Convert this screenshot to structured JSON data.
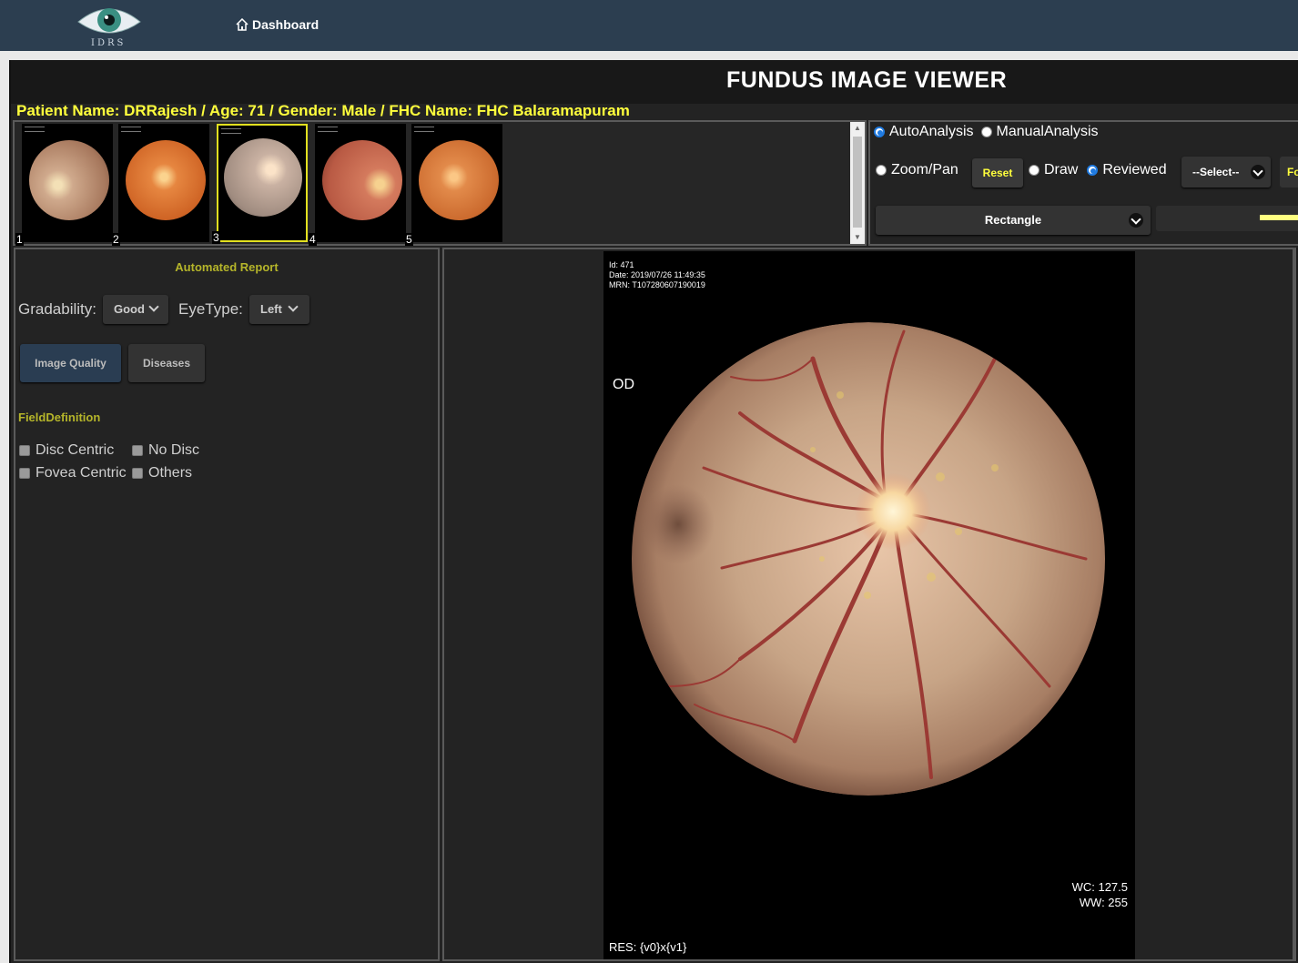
{
  "nav": {
    "logo_text": "IDRS",
    "dashboard_label": "Dashboard"
  },
  "viewer": {
    "title": "FUNDUS IMAGE VIEWER",
    "patient_info": "Patient Name: DRRajesh /  Age: 71 /  Gender: Male /  FHC Name: FHC Balaramapuram",
    "thumbnails": [
      {
        "num": "1",
        "tint": "#c9a58c",
        "selected": false
      },
      {
        "num": "2",
        "tint": "#d9793a",
        "selected": false
      },
      {
        "num": "3",
        "tint": "#c8b5a8",
        "selected": true
      },
      {
        "num": "4",
        "tint": "#d0725a",
        "selected": false
      },
      {
        "num": "5",
        "tint": "#d9803e",
        "selected": false
      }
    ]
  },
  "controls": {
    "auto_analysis": "AutoAnalysis",
    "manual_analysis": "ManualAnalysis",
    "zoom_pan": "Zoom/Pan",
    "reset": "Reset",
    "draw": "Draw",
    "reviewed": "Reviewed",
    "select": "--Select--",
    "cut_button": "Fo",
    "shape": "Rectangle",
    "line_color": "#ffff80"
  },
  "report": {
    "title": "Automated Report",
    "gradability_label": "Gradability:",
    "gradability_value": "Good",
    "eyetype_label": "EyeType:",
    "eyetype_value": "Left",
    "tab_image_quality": "Image Quality",
    "tab_diseases": "Diseases",
    "field_definition": "FieldDefinition",
    "options": [
      "Disc Centric",
      "No Disc",
      "Fovea Centric",
      "Others"
    ]
  },
  "image": {
    "meta": [
      "Id: 471",
      "Date: 2019/07/26 11:49:35",
      "MRN: T107280607190019"
    ],
    "eye_label": "OD",
    "wc": "WC: 127.5",
    "ww": "WW: 255",
    "res": "RES: {v0}x{v1}"
  }
}
